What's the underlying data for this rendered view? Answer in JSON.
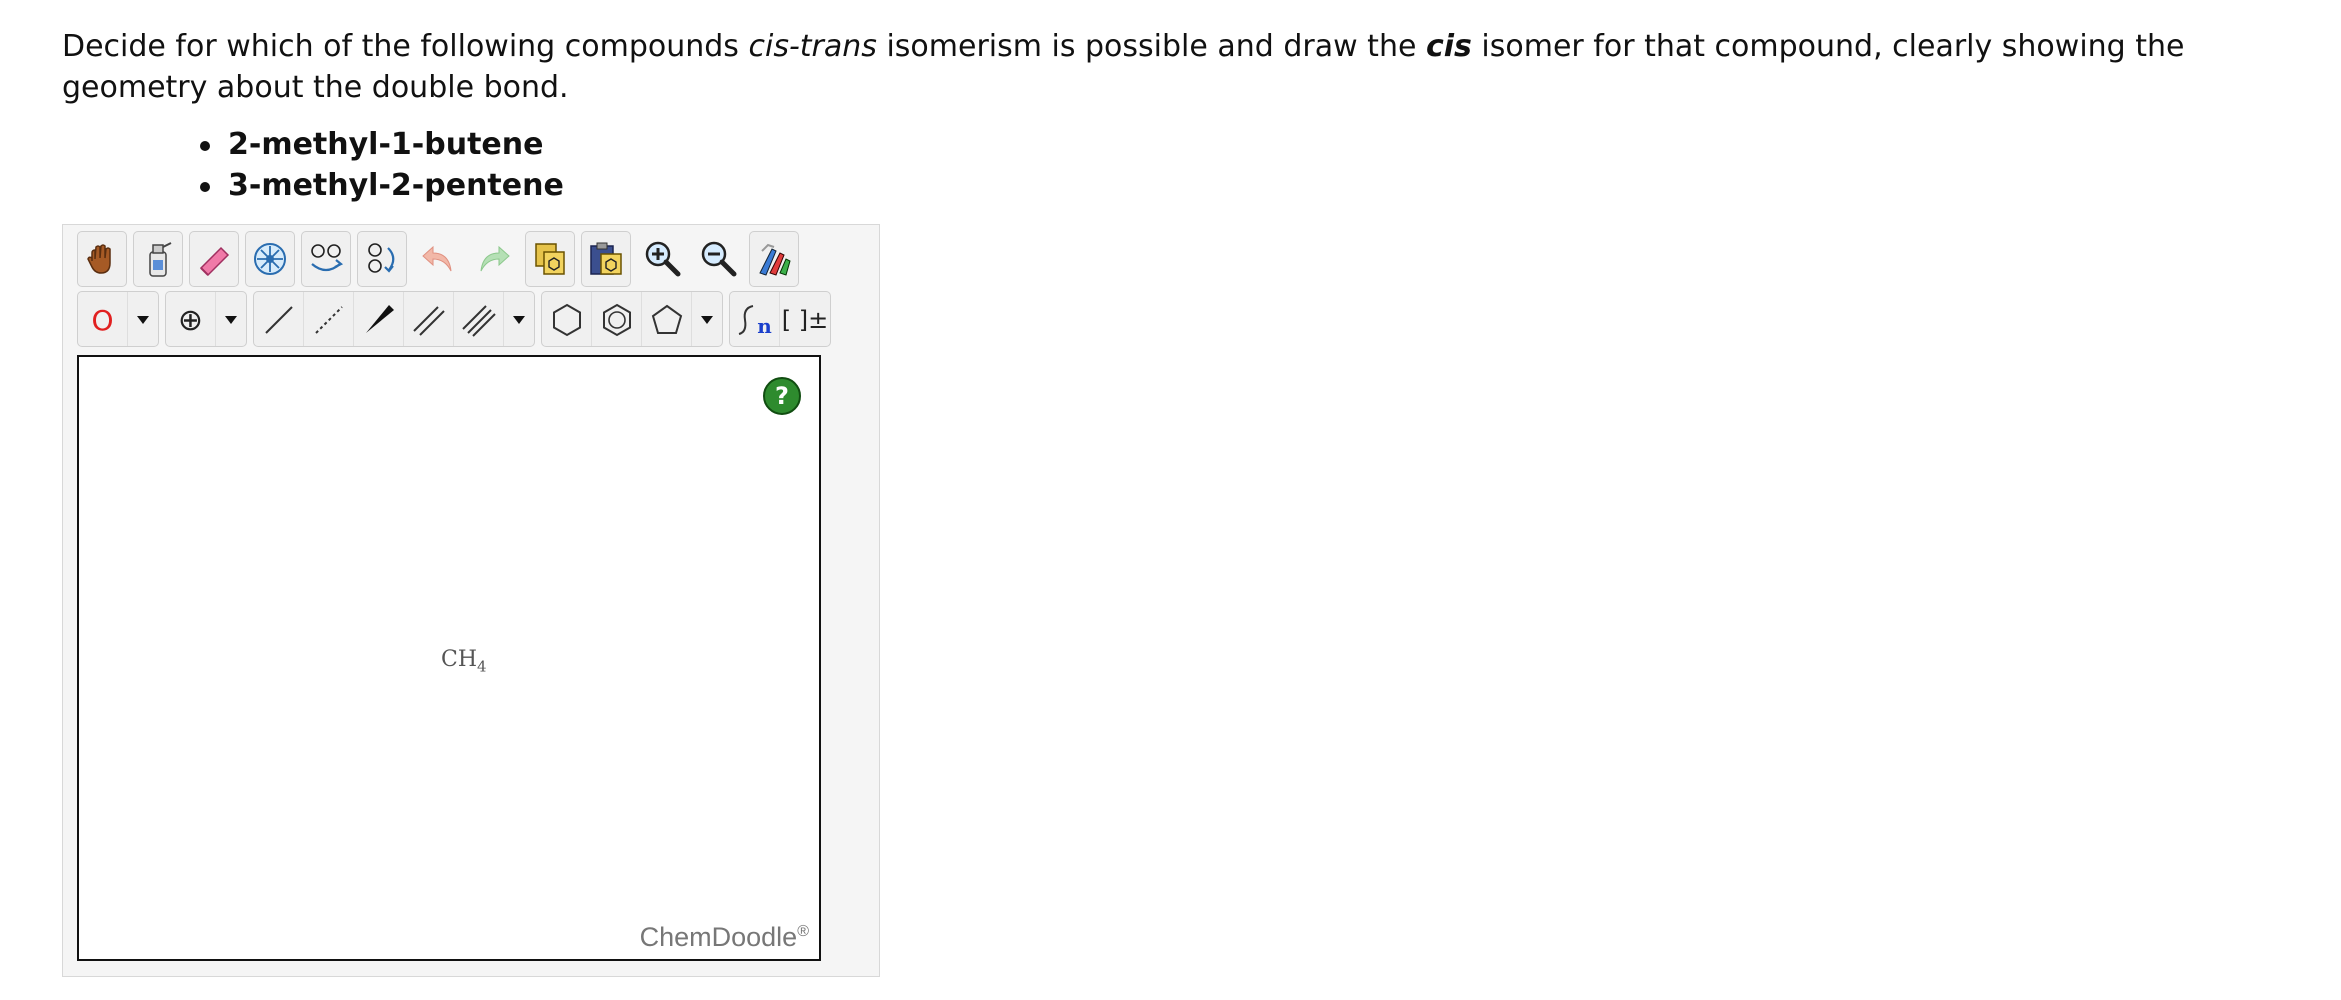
{
  "question": {
    "text_1": "Decide for which of the following compounds ",
    "em_1": "cis-trans",
    "text_2": " isomerism is possible and draw the ",
    "strong_em": "cis",
    "text_3": " isomer for that compound, clearly showing the geometry about the double bond."
  },
  "compounds": [
    "2-methyl-1-butene",
    "3-methyl-2-pentene"
  ],
  "toolbar": {
    "row1": [
      {
        "name": "pan-hand-icon"
      },
      {
        "name": "clear-bottle-icon"
      },
      {
        "name": "eraser-icon"
      },
      {
        "name": "center-icon"
      },
      {
        "name": "flip-icon"
      },
      {
        "name": "rotate-icon"
      },
      {
        "name": "undo-icon"
      },
      {
        "name": "redo-icon"
      },
      {
        "name": "copy-icon"
      },
      {
        "name": "paste-icon"
      },
      {
        "name": "zoom-in-icon"
      },
      {
        "name": "zoom-out-icon"
      },
      {
        "name": "clean-icon"
      }
    ],
    "atom_label": "O",
    "charge_label": "⊕",
    "bracket_label": "[ ]±",
    "sgroup_label": "n"
  },
  "canvas": {
    "help_label": "?",
    "molecule_main": "CH",
    "molecule_sub": "4",
    "brand_text": "ChemDoodle",
    "brand_mark": "®"
  },
  "colors": {
    "atom_red": "#e12020",
    "help_green": "#2e8b2e",
    "canvas_border": "#111111"
  }
}
